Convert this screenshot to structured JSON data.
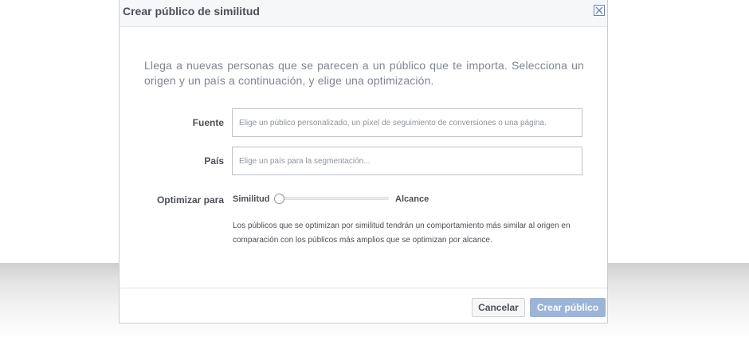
{
  "dialog": {
    "title": "Crear público de similitud",
    "intro": "Llega a nuevas personas que se parecen a un público que te importa. Selecciona un origen y un país a continuación, y elige una optimización."
  },
  "form": {
    "source": {
      "label": "Fuente",
      "placeholder": "Elige un público personalizado, un píxel de seguimiento de conversiones o una página."
    },
    "country": {
      "label": "País",
      "placeholder": "Elige un país para la segmentación..."
    },
    "optimize": {
      "label": "Optimizar para",
      "min_label": "Similitud",
      "max_label": "Alcance",
      "value": 0,
      "help": "Los públicos que se optimizan por similitud tendrán un comportamiento más similar al origen en comparación con los públicos más amplios que se optimizan por alcance."
    }
  },
  "footer": {
    "cancel_label": "Cancelar",
    "create_label": "Crear público"
  },
  "icons": {
    "close": "close-icon"
  },
  "colors": {
    "primary_disabled": "#9cb4d8",
    "header_bg": "#f6f7f9",
    "close_border": "#6d84b4"
  }
}
